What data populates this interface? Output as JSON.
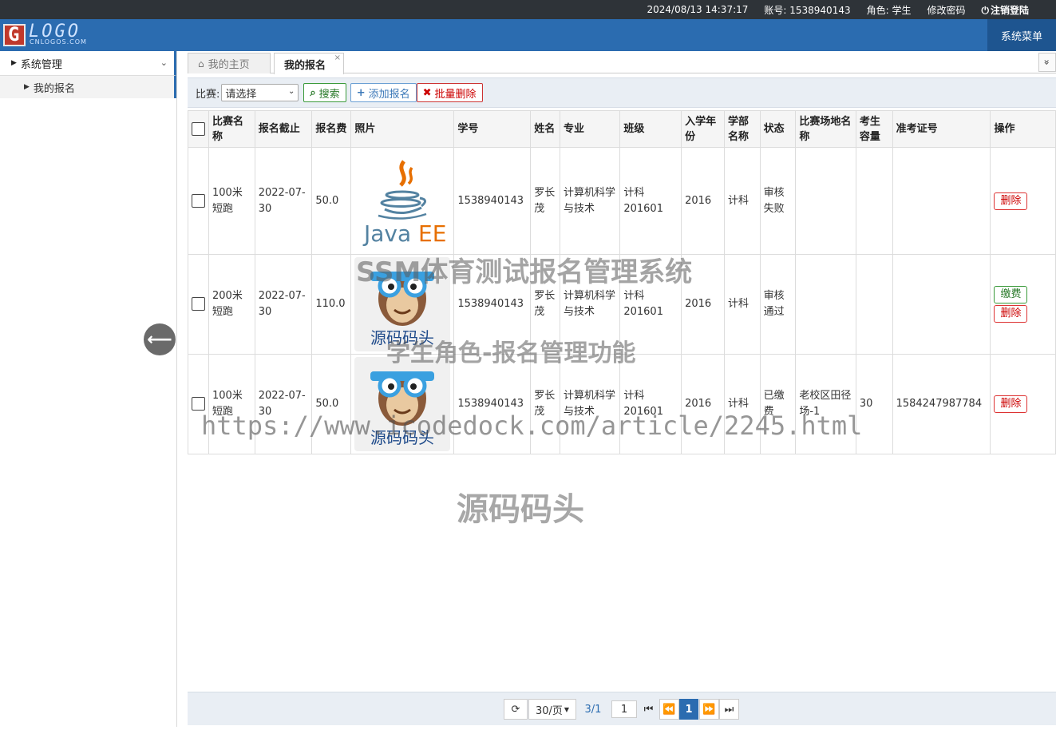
{
  "topbar": {
    "datetime": "2024/08/13 14:37:17",
    "account": "账号: 1538940143",
    "role": "角色: 学生",
    "change_password": "修改密码",
    "logout": "注销登陆"
  },
  "header": {
    "logo_text": "LOGO",
    "logo_sub": "CNLOGOS.COM",
    "system_menu": "系统菜单"
  },
  "sidebar": {
    "group_label": "系统管理",
    "items": [
      {
        "label": "我的报名"
      }
    ]
  },
  "tabs": {
    "home": "我的主页",
    "active": "我的报名",
    "close": "×",
    "more": "»"
  },
  "toolbar": {
    "filter_label": "比赛:",
    "select_value": "请选择",
    "search_label": "搜索",
    "add_label": "添加报名",
    "batch_delete_label": "批量删除"
  },
  "table": {
    "headers": [
      "比赛名称",
      "报名截止",
      "报名费",
      "照片",
      "学号",
      "姓名",
      "专业",
      "班级",
      "入学年份",
      "学部名称",
      "状态",
      "比赛场地名称",
      "考生容量",
      "准考证号",
      "操作"
    ],
    "rows": [
      {
        "name": "100米短跑",
        "deadline": "2022-07-30",
        "fee": "50.0",
        "photo": "java-ee-logo",
        "student_id": "1538940143",
        "student_name": "罗长茂",
        "major": "计算机科学与技术",
        "class": "计科201601",
        "year": "2016",
        "dept": "计科",
        "status": "审核失败",
        "venue": "",
        "capacity": "",
        "ticket": "",
        "actions": [
          "删除"
        ]
      },
      {
        "name": "200米短跑",
        "deadline": "2022-07-30",
        "fee": "110.0",
        "photo": "monkey-logo",
        "student_id": "1538940143",
        "student_name": "罗长茂",
        "major": "计算机科学与技术",
        "class": "计科201601",
        "year": "2016",
        "dept": "计科",
        "status": "审核通过",
        "venue": "",
        "capacity": "",
        "ticket": "",
        "actions": [
          "缴费",
          "删除"
        ]
      },
      {
        "name": "100米短跑",
        "deadline": "2022-07-30",
        "fee": "50.0",
        "photo": "monkey-logo",
        "student_id": "1538940143",
        "student_name": "罗长茂",
        "major": "计算机科学与技术",
        "class": "计科201601",
        "year": "2016",
        "dept": "计科",
        "status": "已缴费",
        "venue": "老校区田径场-1",
        "capacity": "30",
        "ticket": "1584247987784",
        "actions": [
          "删除"
        ]
      }
    ]
  },
  "pager": {
    "page_size": "30/页",
    "page_info": "3/1",
    "page_input": "1",
    "current_page": "1"
  },
  "watermarks": {
    "title": "SSM体育测试报名管理系统",
    "subtitle": "学生角色-报名管理功能",
    "url": "https://www.icodedock.com/article/2245.html",
    "brand": "源码码头"
  },
  "images": {
    "java_text": "Java EE",
    "monkey_text": "源码码头"
  },
  "colors": {
    "primary": "#2b6cb0",
    "topbar": "#2e3338",
    "danger": "#cc0000",
    "success": "#2a7a2a"
  }
}
